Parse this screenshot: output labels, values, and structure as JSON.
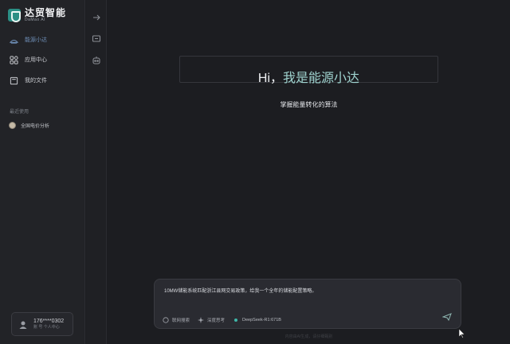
{
  "app": {
    "logo_title": "达贸智能",
    "logo_sub": "DaMao AI"
  },
  "sidebar": {
    "nav": [
      {
        "label": "能源小达",
        "icon": "robot-icon",
        "active": true
      },
      {
        "label": "应用中心",
        "icon": "apps-grid-icon",
        "active": false
      },
      {
        "label": "我的文件",
        "icon": "file-icon",
        "active": false
      }
    ],
    "recent_section_label": "最近使用",
    "recent_items": [
      {
        "label": "全国电价分析",
        "icon": "avatar-icon"
      }
    ],
    "user": {
      "phone": "176****0302",
      "meta": "账 号 个人中心",
      "icon": "user-icon"
    }
  },
  "rail": {
    "icons": [
      "collapse-arrow-icon",
      "new-chat-icon",
      "robot-chat-icon"
    ]
  },
  "main": {
    "greeting_prefix": "Hi，",
    "greeting_main": "我是能源小达",
    "tagline": "掌握能量转化的算法",
    "composer": {
      "text": "10MW储能系统匹配浙江县网交易政策，给我一个全年的储能配置策略。",
      "toolbar": [
        {
          "label": "联网搜索",
          "icon": "globe-icon"
        },
        {
          "label": "深度思考",
          "icon": "sparkle-icon"
        },
        {
          "label": "DeepSeek-R1:671B",
          "icon": "model-dot-icon"
        }
      ],
      "send_icon": "send-icon"
    },
    "footer_note": "内容由AI生成，请仔细甄别"
  },
  "colors": {
    "accent_teal": "#2a8f85",
    "active_nav": "#6f8fb8",
    "greeting_accent": "#9fd3cf",
    "model_dot": "#3fb7a8"
  }
}
